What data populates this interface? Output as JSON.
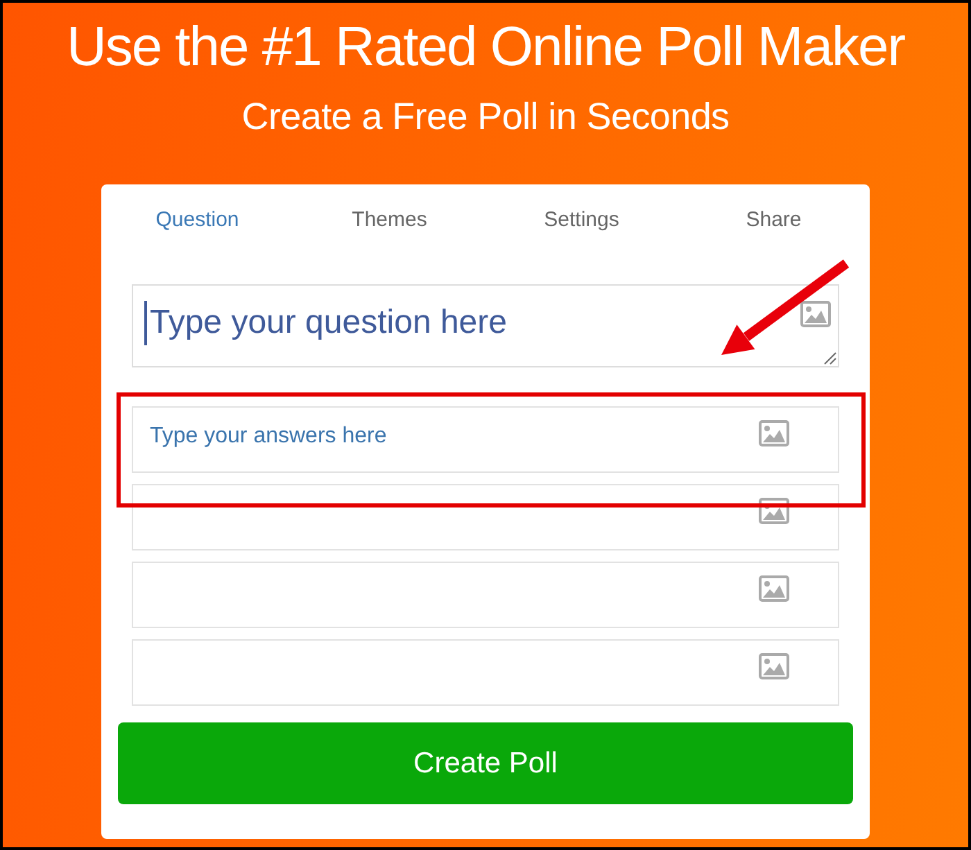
{
  "header": {
    "title": "Use the #1 Rated Online Poll Maker",
    "subtitle": "Create a Free Poll in Seconds"
  },
  "tabs": [
    {
      "label": "Question",
      "selected": true
    },
    {
      "label": "Themes",
      "selected": false
    },
    {
      "label": "Settings",
      "selected": false
    },
    {
      "label": "Share",
      "selected": false
    }
  ],
  "question": {
    "placeholder": "Type your question here",
    "focused": true
  },
  "answers": [
    {
      "placeholder": "Type your answers here",
      "image_button": true
    },
    {
      "image_button": true
    },
    {
      "image_button": true
    },
    {
      "image_button": true
    }
  ],
  "create_button": {
    "label": "Create Poll"
  },
  "annotations": {
    "arrow": true,
    "highlight_box": true
  }
}
